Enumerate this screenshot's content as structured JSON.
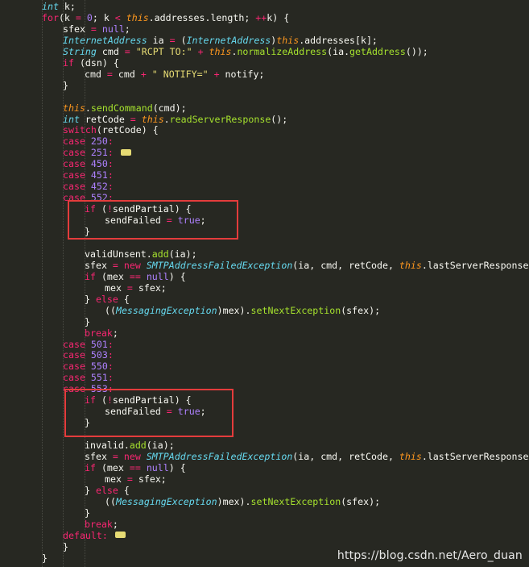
{
  "colors": {
    "background": "#272822",
    "keyword": "#f92672",
    "type": "#66d9ef",
    "this_keyword": "#fd971f",
    "number": "#ae81ff",
    "string": "#e6db74",
    "function": "#a6e22e",
    "plain": "#f8f8f2",
    "highlight_box": "#e43c3c"
  },
  "code_lines": [
    {
      "indent": 52,
      "tokens": [
        {
          "c": "ty",
          "t": "int"
        },
        {
          "c": "pl",
          "t": " k;"
        }
      ]
    },
    {
      "indent": 52,
      "tokens": [
        {
          "c": "kw",
          "t": "for"
        },
        {
          "c": "pl",
          "t": "(k "
        },
        {
          "c": "kw",
          "t": "="
        },
        {
          "c": "pl",
          "t": " "
        },
        {
          "c": "num",
          "t": "0"
        },
        {
          "c": "pl",
          "t": "; k "
        },
        {
          "c": "kw",
          "t": "<"
        },
        {
          "c": "pl",
          "t": " "
        },
        {
          "c": "th",
          "t": "this"
        },
        {
          "c": "pl",
          "t": ".addresses.length; "
        },
        {
          "c": "kw",
          "t": "++"
        },
        {
          "c": "pl",
          "t": "k) {"
        }
      ]
    },
    {
      "indent": 78,
      "tokens": [
        {
          "c": "pl",
          "t": "sfex "
        },
        {
          "c": "kw",
          "t": "="
        },
        {
          "c": "pl",
          "t": " "
        },
        {
          "c": "num",
          "t": "null"
        },
        {
          "c": "pl",
          "t": ";"
        }
      ]
    },
    {
      "indent": 78,
      "tokens": [
        {
          "c": "cl",
          "t": "InternetAddress"
        },
        {
          "c": "pl",
          "t": " ia "
        },
        {
          "c": "kw",
          "t": "="
        },
        {
          "c": "pl",
          "t": " ("
        },
        {
          "c": "cl",
          "t": "InternetAddress"
        },
        {
          "c": "pl",
          "t": ")"
        },
        {
          "c": "th",
          "t": "this"
        },
        {
          "c": "pl",
          "t": ".addresses[k];"
        }
      ]
    },
    {
      "indent": 78,
      "tokens": [
        {
          "c": "cl",
          "t": "String"
        },
        {
          "c": "pl",
          "t": " cmd "
        },
        {
          "c": "kw",
          "t": "="
        },
        {
          "c": "pl",
          "t": " "
        },
        {
          "c": "str",
          "t": "\"RCPT TO:\""
        },
        {
          "c": "pl",
          "t": " "
        },
        {
          "c": "kw",
          "t": "+"
        },
        {
          "c": "pl",
          "t": " "
        },
        {
          "c": "th",
          "t": "this"
        },
        {
          "c": "pl",
          "t": "."
        },
        {
          "c": "fn",
          "t": "normalizeAddress"
        },
        {
          "c": "pl",
          "t": "(ia."
        },
        {
          "c": "fn",
          "t": "getAddress"
        },
        {
          "c": "pl",
          "t": "());"
        }
      ]
    },
    {
      "indent": 78,
      "tokens": [
        {
          "c": "kw",
          "t": "if"
        },
        {
          "c": "pl",
          "t": " (dsn) {"
        }
      ]
    },
    {
      "indent": 105,
      "tokens": [
        {
          "c": "pl",
          "t": "cmd "
        },
        {
          "c": "kw",
          "t": "="
        },
        {
          "c": "pl",
          "t": " cmd "
        },
        {
          "c": "kw",
          "t": "+"
        },
        {
          "c": "pl",
          "t": " "
        },
        {
          "c": "str",
          "t": "\" NOTIFY=\""
        },
        {
          "c": "pl",
          "t": " "
        },
        {
          "c": "kw",
          "t": "+"
        },
        {
          "c": "pl",
          "t": " notify;"
        }
      ]
    },
    {
      "indent": 78,
      "tokens": [
        {
          "c": "pl",
          "t": "}"
        }
      ]
    },
    {
      "indent": 78,
      "tokens": []
    },
    {
      "indent": 78,
      "tokens": [
        {
          "c": "th",
          "t": "this"
        },
        {
          "c": "pl",
          "t": "."
        },
        {
          "c": "fn",
          "t": "sendCommand"
        },
        {
          "c": "pl",
          "t": "(cmd);"
        }
      ]
    },
    {
      "indent": 78,
      "tokens": [
        {
          "c": "ty",
          "t": "int"
        },
        {
          "c": "pl",
          "t": " retCode "
        },
        {
          "c": "kw",
          "t": "="
        },
        {
          "c": "pl",
          "t": " "
        },
        {
          "c": "th",
          "t": "this"
        },
        {
          "c": "pl",
          "t": "."
        },
        {
          "c": "fn",
          "t": "readServerResponse"
        },
        {
          "c": "pl",
          "t": "();"
        }
      ]
    },
    {
      "indent": 78,
      "tokens": [
        {
          "c": "kw",
          "t": "switch"
        },
        {
          "c": "pl",
          "t": "(retCode) {"
        }
      ]
    },
    {
      "indent": 78,
      "tokens": [
        {
          "c": "kw",
          "t": "case"
        },
        {
          "c": "pl",
          "t": " "
        },
        {
          "c": "num",
          "t": "250"
        },
        {
          "c": "kw",
          "t": ":"
        }
      ]
    },
    {
      "indent": 78,
      "tokens": [
        {
          "c": "kw",
          "t": "case"
        },
        {
          "c": "pl",
          "t": " "
        },
        {
          "c": "num",
          "t": "251"
        },
        {
          "c": "kw",
          "t": ":"
        },
        {
          "c": "pl",
          "t": " "
        },
        {
          "c": "fold",
          "t": ""
        }
      ]
    },
    {
      "indent": 78,
      "tokens": [
        {
          "c": "kw",
          "t": "case"
        },
        {
          "c": "pl",
          "t": " "
        },
        {
          "c": "num",
          "t": "450"
        },
        {
          "c": "kw",
          "t": ":"
        }
      ]
    },
    {
      "indent": 78,
      "tokens": [
        {
          "c": "kw",
          "t": "case"
        },
        {
          "c": "pl",
          "t": " "
        },
        {
          "c": "num",
          "t": "451"
        },
        {
          "c": "kw",
          "t": ":"
        }
      ]
    },
    {
      "indent": 78,
      "tokens": [
        {
          "c": "kw",
          "t": "case"
        },
        {
          "c": "pl",
          "t": " "
        },
        {
          "c": "num",
          "t": "452"
        },
        {
          "c": "kw",
          "t": ":"
        }
      ]
    },
    {
      "indent": 78,
      "tokens": [
        {
          "c": "kw",
          "t": "case"
        },
        {
          "c": "pl",
          "t": " "
        },
        {
          "c": "num",
          "t": "552"
        },
        {
          "c": "kw",
          "t": ":"
        }
      ]
    },
    {
      "indent": 105,
      "tokens": [
        {
          "c": "kw",
          "t": "if"
        },
        {
          "c": "pl",
          "t": " ("
        },
        {
          "c": "kw",
          "t": "!"
        },
        {
          "c": "pl",
          "t": "sendPartial) {"
        }
      ]
    },
    {
      "indent": 130,
      "tokens": [
        {
          "c": "pl",
          "t": "sendFailed "
        },
        {
          "c": "kw",
          "t": "="
        },
        {
          "c": "pl",
          "t": " "
        },
        {
          "c": "num",
          "t": "true"
        },
        {
          "c": "pl",
          "t": ";"
        }
      ]
    },
    {
      "indent": 105,
      "tokens": [
        {
          "c": "pl",
          "t": "}"
        }
      ]
    },
    {
      "indent": 105,
      "tokens": []
    },
    {
      "indent": 105,
      "tokens": [
        {
          "c": "pl",
          "t": "validUnsent."
        },
        {
          "c": "fn",
          "t": "add"
        },
        {
          "c": "pl",
          "t": "(ia);"
        }
      ]
    },
    {
      "indent": 105,
      "tokens": [
        {
          "c": "pl",
          "t": "sfex "
        },
        {
          "c": "kw",
          "t": "="
        },
        {
          "c": "pl",
          "t": " "
        },
        {
          "c": "kw",
          "t": "new"
        },
        {
          "c": "pl",
          "t": " "
        },
        {
          "c": "cl",
          "t": "SMTPAddressFailedException"
        },
        {
          "c": "pl",
          "t": "(ia, cmd, retCode, "
        },
        {
          "c": "th",
          "t": "this"
        },
        {
          "c": "pl",
          "t": ".lastServerResponse);"
        }
      ]
    },
    {
      "indent": 105,
      "tokens": [
        {
          "c": "kw",
          "t": "if"
        },
        {
          "c": "pl",
          "t": " (mex "
        },
        {
          "c": "kw",
          "t": "=="
        },
        {
          "c": "pl",
          "t": " "
        },
        {
          "c": "num",
          "t": "null"
        },
        {
          "c": "pl",
          "t": ") {"
        }
      ]
    },
    {
      "indent": 130,
      "tokens": [
        {
          "c": "pl",
          "t": "mex "
        },
        {
          "c": "kw",
          "t": "="
        },
        {
          "c": "pl",
          "t": " sfex;"
        }
      ]
    },
    {
      "indent": 105,
      "tokens": [
        {
          "c": "pl",
          "t": "} "
        },
        {
          "c": "kw",
          "t": "else"
        },
        {
          "c": "pl",
          "t": " {"
        }
      ]
    },
    {
      "indent": 130,
      "tokens": [
        {
          "c": "pl",
          "t": "(("
        },
        {
          "c": "cl",
          "t": "MessagingException"
        },
        {
          "c": "pl",
          "t": ")mex)."
        },
        {
          "c": "fn",
          "t": "setNextException"
        },
        {
          "c": "pl",
          "t": "(sfex);"
        }
      ]
    },
    {
      "indent": 105,
      "tokens": [
        {
          "c": "pl",
          "t": "}"
        }
      ]
    },
    {
      "indent": 105,
      "tokens": [
        {
          "c": "kw",
          "t": "break"
        },
        {
          "c": "pl",
          "t": ";"
        }
      ]
    },
    {
      "indent": 78,
      "tokens": [
        {
          "c": "kw",
          "t": "case"
        },
        {
          "c": "pl",
          "t": " "
        },
        {
          "c": "num",
          "t": "501"
        },
        {
          "c": "kw",
          "t": ":"
        }
      ]
    },
    {
      "indent": 78,
      "tokens": [
        {
          "c": "kw",
          "t": "case"
        },
        {
          "c": "pl",
          "t": " "
        },
        {
          "c": "num",
          "t": "503"
        },
        {
          "c": "kw",
          "t": ":"
        }
      ]
    },
    {
      "indent": 78,
      "tokens": [
        {
          "c": "kw",
          "t": "case"
        },
        {
          "c": "pl",
          "t": " "
        },
        {
          "c": "num",
          "t": "550"
        },
        {
          "c": "kw",
          "t": ":"
        }
      ]
    },
    {
      "indent": 78,
      "tokens": [
        {
          "c": "kw",
          "t": "case"
        },
        {
          "c": "pl",
          "t": " "
        },
        {
          "c": "num",
          "t": "551"
        },
        {
          "c": "kw",
          "t": ":"
        }
      ]
    },
    {
      "indent": 78,
      "tokens": [
        {
          "c": "kw",
          "t": "case"
        },
        {
          "c": "pl",
          "t": " "
        },
        {
          "c": "num",
          "t": "553"
        },
        {
          "c": "kw",
          "t": ":"
        }
      ]
    },
    {
      "indent": 105,
      "tokens": [
        {
          "c": "kw",
          "t": "if"
        },
        {
          "c": "pl",
          "t": " ("
        },
        {
          "c": "kw",
          "t": "!"
        },
        {
          "c": "pl",
          "t": "sendPartial) {"
        }
      ]
    },
    {
      "indent": 130,
      "tokens": [
        {
          "c": "pl",
          "t": "sendFailed "
        },
        {
          "c": "kw",
          "t": "="
        },
        {
          "c": "pl",
          "t": " "
        },
        {
          "c": "num",
          "t": "true"
        },
        {
          "c": "pl",
          "t": ";"
        }
      ]
    },
    {
      "indent": 105,
      "tokens": [
        {
          "c": "pl",
          "t": "}"
        }
      ]
    },
    {
      "indent": 105,
      "tokens": []
    },
    {
      "indent": 105,
      "tokens": [
        {
          "c": "pl",
          "t": "invalid."
        },
        {
          "c": "fn",
          "t": "add"
        },
        {
          "c": "pl",
          "t": "(ia);"
        }
      ]
    },
    {
      "indent": 105,
      "tokens": [
        {
          "c": "pl",
          "t": "sfex "
        },
        {
          "c": "kw",
          "t": "="
        },
        {
          "c": "pl",
          "t": " "
        },
        {
          "c": "kw",
          "t": "new"
        },
        {
          "c": "pl",
          "t": " "
        },
        {
          "c": "cl",
          "t": "SMTPAddressFailedException"
        },
        {
          "c": "pl",
          "t": "(ia, cmd, retCode, "
        },
        {
          "c": "th",
          "t": "this"
        },
        {
          "c": "pl",
          "t": ".lastServerResponse);"
        }
      ]
    },
    {
      "indent": 105,
      "tokens": [
        {
          "c": "kw",
          "t": "if"
        },
        {
          "c": "pl",
          "t": " (mex "
        },
        {
          "c": "kw",
          "t": "=="
        },
        {
          "c": "pl",
          "t": " "
        },
        {
          "c": "num",
          "t": "null"
        },
        {
          "c": "pl",
          "t": ") {"
        }
      ]
    },
    {
      "indent": 130,
      "tokens": [
        {
          "c": "pl",
          "t": "mex "
        },
        {
          "c": "kw",
          "t": "="
        },
        {
          "c": "pl",
          "t": " sfex;"
        }
      ]
    },
    {
      "indent": 105,
      "tokens": [
        {
          "c": "pl",
          "t": "} "
        },
        {
          "c": "kw",
          "t": "else"
        },
        {
          "c": "pl",
          "t": " {"
        }
      ]
    },
    {
      "indent": 130,
      "tokens": [
        {
          "c": "pl",
          "t": "(("
        },
        {
          "c": "cl",
          "t": "MessagingException"
        },
        {
          "c": "pl",
          "t": ")mex)."
        },
        {
          "c": "fn",
          "t": "setNextException"
        },
        {
          "c": "pl",
          "t": "(sfex);"
        }
      ]
    },
    {
      "indent": 105,
      "tokens": [
        {
          "c": "pl",
          "t": "}"
        }
      ]
    },
    {
      "indent": 105,
      "tokens": [
        {
          "c": "kw",
          "t": "break"
        },
        {
          "c": "pl",
          "t": ";"
        }
      ]
    },
    {
      "indent": 78,
      "tokens": [
        {
          "c": "kw",
          "t": "default"
        },
        {
          "c": "kw",
          "t": ":"
        },
        {
          "c": "pl",
          "t": " "
        },
        {
          "c": "fold",
          "t": ""
        }
      ]
    },
    {
      "indent": 78,
      "tokens": [
        {
          "c": "pl",
          "t": "}"
        }
      ]
    },
    {
      "indent": 52,
      "tokens": [
        {
          "c": "pl",
          "t": "}"
        }
      ]
    }
  ],
  "watermark": "https://blog.csdn.net/Aero_duan"
}
